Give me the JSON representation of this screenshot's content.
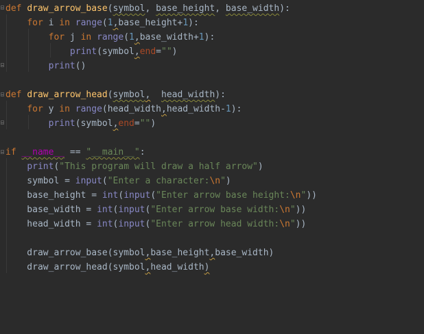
{
  "editor": {
    "colors": {
      "background": "#2b2b2b",
      "keyword": "#cc7832",
      "function": "#ffc66d",
      "builtin": "#8888c6",
      "number": "#6897bb",
      "string": "#6a8759",
      "text": "#a9b7c6"
    },
    "lines": [
      {
        "tokens": [
          {
            "t": "def",
            "c": "kw"
          },
          {
            "t": " ",
            "c": "plain"
          },
          {
            "t": "draw_arrow_base",
            "c": "fn"
          },
          {
            "t": "(",
            "c": "plain"
          },
          {
            "t": "symbol",
            "c": "plain",
            "u": "warn"
          },
          {
            "t": ", ",
            "c": "plain"
          },
          {
            "t": "base_height",
            "c": "plain",
            "u": "warn"
          },
          {
            "t": ", ",
            "c": "plain"
          },
          {
            "t": "base_width",
            "c": "plain",
            "u": "warn"
          },
          {
            "t": "):",
            "c": "plain"
          }
        ]
      },
      {
        "tokens": [
          {
            "t": "    ",
            "c": "plain"
          },
          {
            "t": "for",
            "c": "kw"
          },
          {
            "t": " i ",
            "c": "plain"
          },
          {
            "t": "in",
            "c": "kw"
          },
          {
            "t": " ",
            "c": "plain"
          },
          {
            "t": "range",
            "c": "bi"
          },
          {
            "t": "(",
            "c": "plain"
          },
          {
            "t": "1",
            "c": "num"
          },
          {
            "t": ",",
            "c": "plain",
            "u": "commawarn"
          },
          {
            "t": "base_height+",
            "c": "plain"
          },
          {
            "t": "1",
            "c": "num"
          },
          {
            "t": "):",
            "c": "plain"
          }
        ]
      },
      {
        "tokens": [
          {
            "t": "        ",
            "c": "plain"
          },
          {
            "t": "for",
            "c": "kw"
          },
          {
            "t": " j ",
            "c": "plain"
          },
          {
            "t": "in",
            "c": "kw"
          },
          {
            "t": " ",
            "c": "plain"
          },
          {
            "t": "range",
            "c": "bi"
          },
          {
            "t": "(",
            "c": "plain"
          },
          {
            "t": "1",
            "c": "num"
          },
          {
            "t": ",",
            "c": "plain",
            "u": "commawarn"
          },
          {
            "t": "base_width+",
            "c": "plain"
          },
          {
            "t": "1",
            "c": "num"
          },
          {
            "t": "):",
            "c": "plain"
          }
        ]
      },
      {
        "tokens": [
          {
            "t": "            ",
            "c": "plain"
          },
          {
            "t": "print",
            "c": "bi"
          },
          {
            "t": "(symbol",
            "c": "plain"
          },
          {
            "t": ",",
            "c": "plain",
            "u": "commawarn"
          },
          {
            "t": "end",
            "c": "param"
          },
          {
            "t": "=",
            "c": "plain"
          },
          {
            "t": "\"\"",
            "c": "str"
          },
          {
            "t": ")",
            "c": "plain"
          }
        ]
      },
      {
        "tokens": [
          {
            "t": "        ",
            "c": "plain"
          },
          {
            "t": "print",
            "c": "bi"
          },
          {
            "t": "()",
            "c": "plain"
          }
        ]
      },
      {
        "tokens": []
      },
      {
        "tokens": [
          {
            "t": "def",
            "c": "kw"
          },
          {
            "t": " ",
            "c": "plain"
          },
          {
            "t": "draw_arrow_head",
            "c": "fn"
          },
          {
            "t": "(",
            "c": "plain"
          },
          {
            "t": "symbol",
            "c": "plain",
            "u": "warn"
          },
          {
            "t": ",",
            "c": "plain",
            "u": "commawarn"
          },
          {
            "t": "  ",
            "c": "plain"
          },
          {
            "t": "head_width",
            "c": "plain",
            "u": "warn"
          },
          {
            "t": "):",
            "c": "plain"
          }
        ]
      },
      {
        "tokens": [
          {
            "t": "    ",
            "c": "plain"
          },
          {
            "t": "for",
            "c": "kw"
          },
          {
            "t": " y ",
            "c": "plain"
          },
          {
            "t": "in",
            "c": "kw"
          },
          {
            "t": " ",
            "c": "plain"
          },
          {
            "t": "range",
            "c": "bi"
          },
          {
            "t": "(head_width",
            "c": "plain"
          },
          {
            "t": ",",
            "c": "plain",
            "u": "commawarn"
          },
          {
            "t": "head_width-",
            "c": "plain"
          },
          {
            "t": "1",
            "c": "num"
          },
          {
            "t": "):",
            "c": "plain"
          }
        ]
      },
      {
        "tokens": [
          {
            "t": "        ",
            "c": "plain"
          },
          {
            "t": "print",
            "c": "bi"
          },
          {
            "t": "(symbol",
            "c": "plain"
          },
          {
            "t": ",",
            "c": "plain",
            "u": "commawarn"
          },
          {
            "t": "end",
            "c": "param"
          },
          {
            "t": "=",
            "c": "plain"
          },
          {
            "t": "\"\"",
            "c": "str"
          },
          {
            "t": ")",
            "c": "plain"
          }
        ]
      },
      {
        "tokens": []
      },
      {
        "tokens": [
          {
            "t": "if",
            "c": "kw"
          },
          {
            "t": " ",
            "c": "plain"
          },
          {
            "t": "__name__",
            "c": "dunder",
            "u": "warn"
          },
          {
            "t": " == ",
            "c": "plain"
          },
          {
            "t": "\"__main__\"",
            "c": "str",
            "u": "warn"
          },
          {
            "t": ":",
            "c": "plain"
          }
        ]
      },
      {
        "tokens": [
          {
            "t": "    ",
            "c": "plain"
          },
          {
            "t": "print",
            "c": "bi"
          },
          {
            "t": "(",
            "c": "plain"
          },
          {
            "t": "\"This program will draw a half arrow\"",
            "c": "str"
          },
          {
            "t": ")",
            "c": "plain"
          }
        ]
      },
      {
        "tokens": [
          {
            "t": "    symbol = ",
            "c": "plain"
          },
          {
            "t": "input",
            "c": "bi"
          },
          {
            "t": "(",
            "c": "plain"
          },
          {
            "t": "\"Enter a character:",
            "c": "str"
          },
          {
            "t": "\\n",
            "c": "esc"
          },
          {
            "t": "\"",
            "c": "str"
          },
          {
            "t": ")",
            "c": "plain"
          }
        ]
      },
      {
        "tokens": [
          {
            "t": "    base_height = ",
            "c": "plain"
          },
          {
            "t": "int",
            "c": "bi"
          },
          {
            "t": "(",
            "c": "plain"
          },
          {
            "t": "input",
            "c": "bi"
          },
          {
            "t": "(",
            "c": "plain"
          },
          {
            "t": "\"Enter arrow base height:",
            "c": "str"
          },
          {
            "t": "\\n",
            "c": "esc"
          },
          {
            "t": "\"",
            "c": "str"
          },
          {
            "t": "))",
            "c": "plain"
          }
        ]
      },
      {
        "tokens": [
          {
            "t": "    base_width = ",
            "c": "plain"
          },
          {
            "t": "int",
            "c": "bi"
          },
          {
            "t": "(",
            "c": "plain"
          },
          {
            "t": "input",
            "c": "bi"
          },
          {
            "t": "(",
            "c": "plain"
          },
          {
            "t": "\"Enter arrow base width:",
            "c": "str"
          },
          {
            "t": "\\n",
            "c": "esc"
          },
          {
            "t": "\"",
            "c": "str"
          },
          {
            "t": "))",
            "c": "plain"
          }
        ]
      },
      {
        "tokens": [
          {
            "t": "    head_width = ",
            "c": "plain"
          },
          {
            "t": "int",
            "c": "bi"
          },
          {
            "t": "(",
            "c": "plain"
          },
          {
            "t": "input",
            "c": "bi"
          },
          {
            "t": "(",
            "c": "plain"
          },
          {
            "t": "\"Enter arrow head width:",
            "c": "str"
          },
          {
            "t": "\\n",
            "c": "esc"
          },
          {
            "t": "\"",
            "c": "str"
          },
          {
            "t": "))",
            "c": "plain"
          }
        ]
      },
      {
        "tokens": []
      },
      {
        "tokens": [
          {
            "t": "    draw_arrow_base(symbol",
            "c": "plain"
          },
          {
            "t": ",",
            "c": "plain",
            "u": "commawarn"
          },
          {
            "t": "base_height",
            "c": "plain"
          },
          {
            "t": ",",
            "c": "plain",
            "u": "commawarn"
          },
          {
            "t": "base_width)",
            "c": "plain"
          }
        ]
      },
      {
        "tokens": [
          {
            "t": "    draw_arrow_head(symbol",
            "c": "plain"
          },
          {
            "t": ",",
            "c": "plain",
            "u": "commawarn"
          },
          {
            "t": "head_width",
            "c": "plain"
          },
          {
            "t": ")",
            "c": "plain",
            "u": "commawarn"
          }
        ]
      }
    ]
  }
}
